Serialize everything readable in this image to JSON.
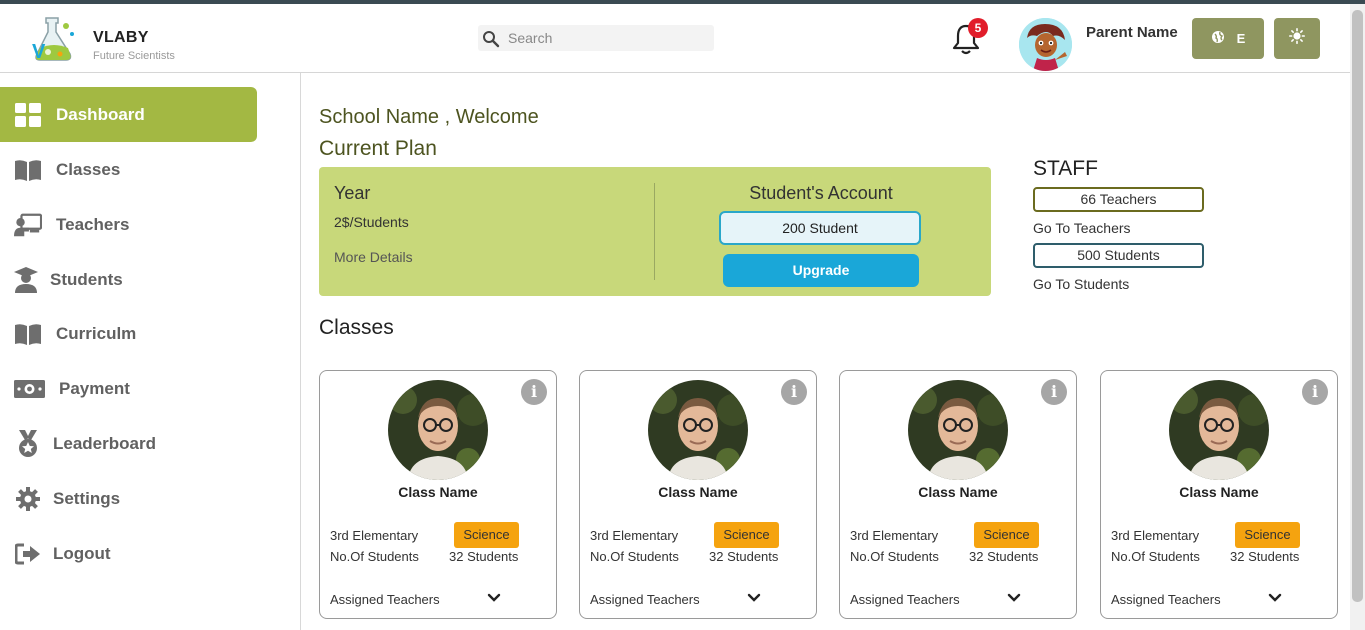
{
  "header": {
    "brand": "VLABY",
    "tagline": "Future Scientists",
    "search_placeholder": "Search",
    "notifications_count": "5",
    "user_name": "Parent Name",
    "language_label": "E",
    "theme_icon": "sun-icon"
  },
  "sidebar": {
    "items": [
      {
        "label": "Dashboard",
        "icon": "grid-icon",
        "active": true
      },
      {
        "label": "Classes",
        "icon": "book-icon"
      },
      {
        "label": "Teachers",
        "icon": "teacher-icon"
      },
      {
        "label": "Students",
        "icon": "student-icon"
      },
      {
        "label": "Curriculm",
        "icon": "open-book-icon"
      },
      {
        "label": "Payment",
        "icon": "money-icon"
      },
      {
        "label": "Leaderboard",
        "icon": "medal-icon"
      },
      {
        "label": "Settings",
        "icon": "gear-icon"
      },
      {
        "label": "Logout",
        "icon": "logout-icon"
      }
    ]
  },
  "main": {
    "welcome": "School Name , Welcome",
    "current_plan_title": "Current Plan",
    "plan": {
      "period": "Year",
      "price": "2$/Students",
      "more_details": "More Details",
      "account_title": "Student's Account",
      "account_count": "200 Student",
      "upgrade_label": "Upgrade"
    },
    "staff": {
      "title": "STAFF",
      "teachers_count": "66 Teachers",
      "go_teachers": "Go To Teachers",
      "students_count": "500 Students",
      "go_students": "Go To Students"
    },
    "classes_title": "Classes",
    "classes": [
      {
        "name": "Class Name",
        "grade": "3rd Elementary",
        "subject": "Science",
        "students_label": "No.Of Students",
        "students": "32 Students",
        "assigned": "Assigned Teachers"
      },
      {
        "name": "Class Name",
        "grade": "3rd Elementary",
        "subject": "Science",
        "students_label": "No.Of Students",
        "students": "32 Students",
        "assigned": "Assigned Teachers"
      },
      {
        "name": "Class Name",
        "grade": "3rd Elementary",
        "subject": "Science",
        "students_label": "No.Of Students",
        "students": "32 Students",
        "assigned": "Assigned Teachers"
      },
      {
        "name": "Class Name",
        "grade": "3rd Elementary",
        "subject": "Science",
        "students_label": "No.Of Students",
        "students": "32 Students",
        "assigned": "Assigned Teachers"
      }
    ]
  },
  "colors": {
    "accent": "#a3b843",
    "plan_bg": "#c8d87a",
    "upgrade": "#1aa7d8",
    "subject_badge": "#f5a30f",
    "header_button": "#8f9660",
    "notification": "#e11d2a"
  }
}
